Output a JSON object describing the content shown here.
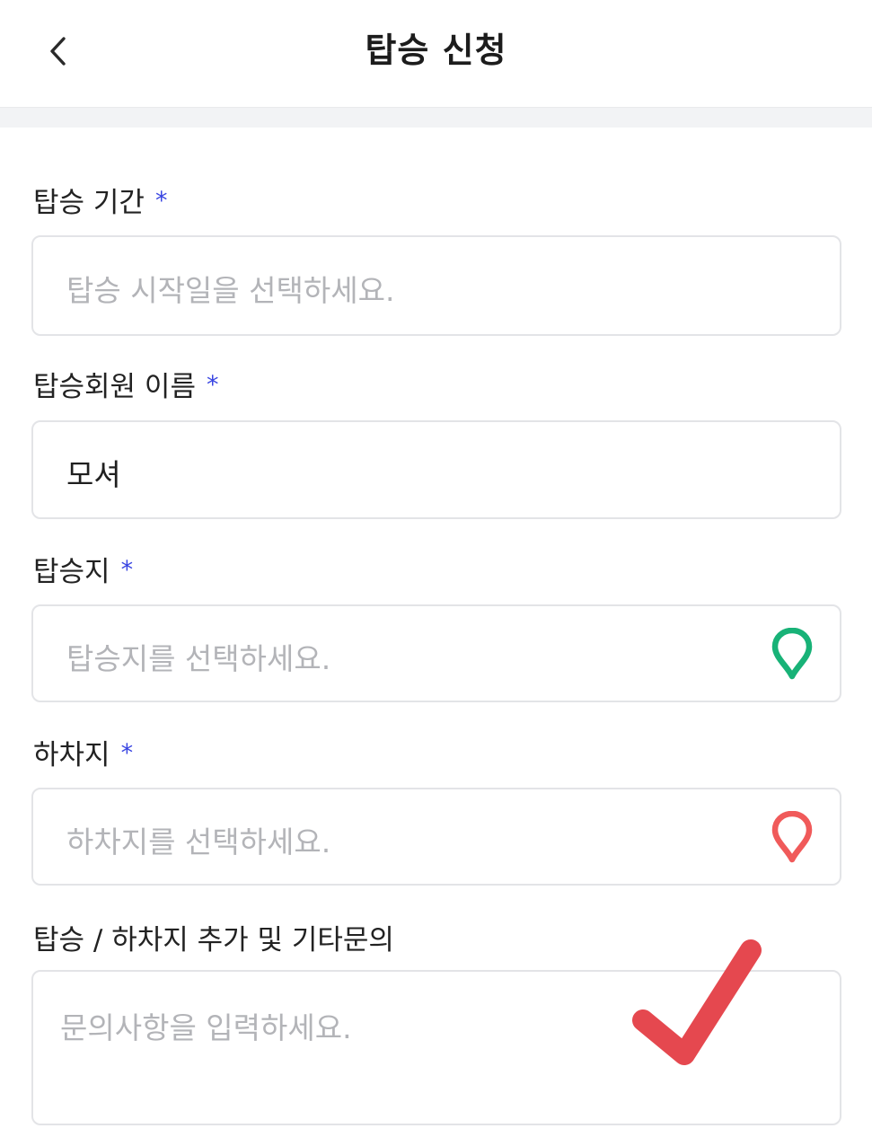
{
  "header": {
    "title": "탑승 신청",
    "back_icon": "chevron-left-icon"
  },
  "form": {
    "required_mark": "*",
    "period": {
      "label": "탑승 기간",
      "placeholder": "탑승 시작일을 선택하세요."
    },
    "member_name": {
      "label": "탑승회원 이름",
      "value": "모셔"
    },
    "boarding": {
      "label": "탑승지",
      "placeholder": "탑승지를 선택하세요.",
      "icon": "location-pin-icon",
      "icon_color": "#18b277"
    },
    "dropoff": {
      "label": "하차지",
      "placeholder": "하차지를 선택하세요.",
      "icon": "location-pin-icon",
      "icon_color": "#f05a5a"
    },
    "inquiry": {
      "label": "탑승 / 하차지 추가 및 기타문의",
      "placeholder": "문의사항을 입력하세요."
    }
  },
  "overlay": {
    "icon": "checkmark-icon",
    "color": "#e5484f"
  },
  "colors": {
    "accent": "#3a46e2",
    "placeholder": "#b3b4b8",
    "border": "#e3e4e7"
  }
}
